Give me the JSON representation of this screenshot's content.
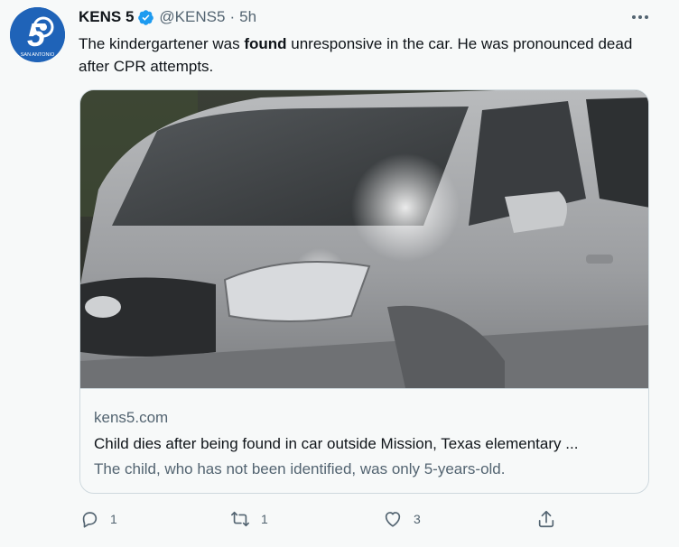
{
  "tweet": {
    "author_name": "KENS 5",
    "handle": "@KENS5",
    "separator": "·",
    "timestamp": "5h",
    "text_before": "The kindergartener was ",
    "text_bold": "found",
    "text_after": " unresponsive in the car. He was pronounced dead after CPR attempts."
  },
  "avatar": {
    "logo_number": "5",
    "logo_text": "SAN ANTONIO",
    "color": "#1f63b8"
  },
  "card": {
    "domain": "kens5.com",
    "headline": "Child dies after being found in car outside Mission, Texas elementary ...",
    "description": "The child, who has not been identified, was only 5-years-old.",
    "image_alt": "silver-suv-photo"
  },
  "actions": {
    "reply_count": "1",
    "retweet_count": "1",
    "like_count": "3"
  },
  "colors": {
    "accent": "#1d9bf0",
    "muted": "#536471",
    "background": "#f7f9f9"
  }
}
